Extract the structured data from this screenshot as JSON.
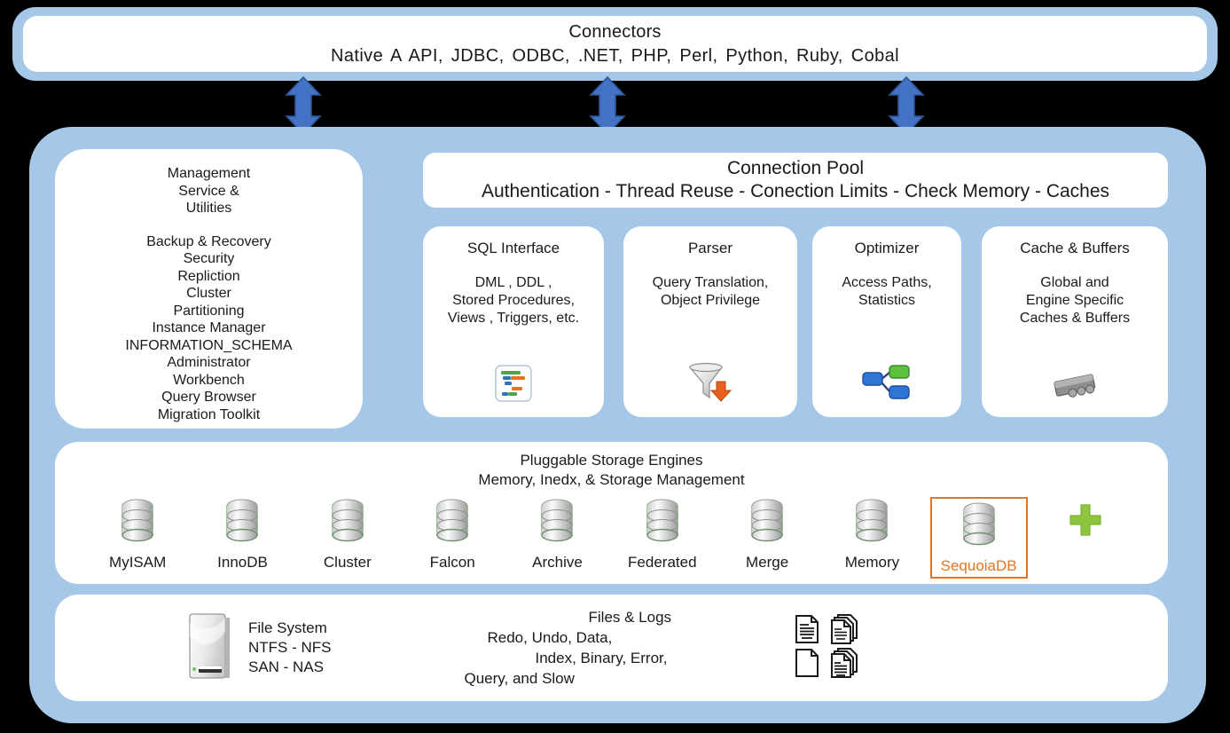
{
  "colors": {
    "panel_blue": "#A5C8E8",
    "arrow_blue": "#4472C4",
    "highlight_orange": "#E8731C",
    "plus_green": "#92D050",
    "background": "#000000"
  },
  "connectors": {
    "title": "Connectors",
    "list": "Native A API,  JDBC,  ODBC,  .NET, PHP,  Perl,  Python,  Ruby,  Cobal"
  },
  "arrows": [
    {
      "name": "connector-arrow-left"
    },
    {
      "name": "connector-arrow-center"
    },
    {
      "name": "connector-arrow-right"
    }
  ],
  "management": {
    "heading": [
      "Management",
      "Service &",
      "Utilities"
    ],
    "items": [
      "Backup & Recovery",
      "Security",
      "Repliction",
      "Cluster",
      "Partitioning",
      "Instance Manager",
      "INFORMATION_SCHEMA",
      "Administrator",
      "Workbench",
      "Query Browser",
      "Migration Toolkit"
    ]
  },
  "connection_pool": {
    "title": "Connection Pool",
    "subtitle": "Authentication - Thread Reuse - Conection Limits - Check Memory - Caches"
  },
  "components": [
    {
      "title": "SQL Interface",
      "desc": [
        "DML , DDL ,",
        "Stored Procedures,",
        "Views , Triggers, etc."
      ],
      "icon": "gantt-chart-icon"
    },
    {
      "title": "Parser",
      "desc": [
        "Query Translation,",
        "Object Privilege"
      ],
      "icon": "funnel-icon"
    },
    {
      "title": "Optimizer",
      "desc": [
        "Access Paths,",
        "Statistics"
      ],
      "icon": "branch-nodes-icon"
    },
    {
      "title": "Cache & Buffers",
      "desc": [
        "Global and",
        "Engine Specific",
        "Caches & Buffers"
      ],
      "icon": "memory-chip-icon"
    }
  ],
  "storage": {
    "heading_line1": "Pluggable Storage Engines",
    "heading_line2": "Memory, Inedx, & Storage Management",
    "engines": [
      {
        "label": "MyISAM",
        "highlighted": false
      },
      {
        "label": "InnoDB",
        "highlighted": false
      },
      {
        "label": "Cluster",
        "highlighted": false
      },
      {
        "label": "Falcon",
        "highlighted": false
      },
      {
        "label": "Archive",
        "highlighted": false
      },
      {
        "label": "Federated",
        "highlighted": false
      },
      {
        "label": "Merge",
        "highlighted": false
      },
      {
        "label": "Memory",
        "highlighted": false
      },
      {
        "label": "SequoiaDB",
        "highlighted": true
      }
    ],
    "add_icon": "plus-icon"
  },
  "files": {
    "filesystem": {
      "icon": "hard-drive-icon",
      "lines": [
        "File System",
        "NTFS - NFS",
        "SAN - NAS"
      ]
    },
    "logs": {
      "title": "Files &  Logs",
      "lines": [
        "Redo, Undo, Data,",
        "Index,  Binary,  Error,",
        "Query,  and  Slow"
      ]
    },
    "doc_icons": [
      "lined-document-icon",
      "stacked-documents-icon",
      "blank-document-icon",
      "stacked-lined-documents-icon"
    ]
  }
}
